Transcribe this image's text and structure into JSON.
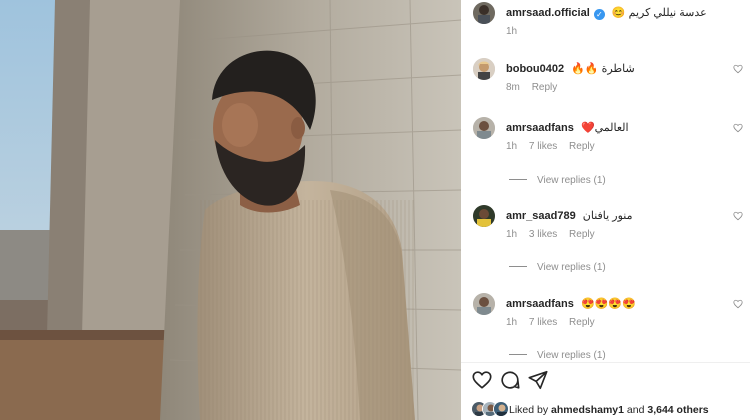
{
  "post": {
    "author": "amrsaad.official",
    "caption": "عدسة نيللي كريم 😊",
    "time": "1h"
  },
  "comments": [
    {
      "username": "bobou0402",
      "text": "شاطرة 🔥🔥",
      "time": "8m",
      "likes": "",
      "reply": "Reply",
      "view_replies": ""
    },
    {
      "username": "amrsaadfans",
      "text": "العالمي❤️",
      "time": "1h",
      "likes": "7 likes",
      "reply": "Reply",
      "view_replies": "View replies (1)"
    },
    {
      "username": "amr_saad789",
      "text": "منور يافنان",
      "time": "1h",
      "likes": "3 likes",
      "reply": "Reply",
      "view_replies": "View replies (1)"
    },
    {
      "username": "amrsaadfans",
      "text": "😍😍😍😍",
      "time": "1h",
      "likes": "7 likes",
      "reply": "Reply",
      "view_replies": "View replies (1)"
    }
  ],
  "likes": {
    "prefix": "Liked by",
    "user": "ahmedshamy1",
    "connector": "and",
    "others": "3,644 others"
  },
  "colors": {
    "link": "#00376b",
    "muted": "#8e8e8e",
    "verified": "#3897f0",
    "heart": "#ed4956"
  },
  "icons": [
    "heart-icon",
    "comment-icon",
    "share-icon",
    "bookmark-icon",
    "verified-icon"
  ]
}
